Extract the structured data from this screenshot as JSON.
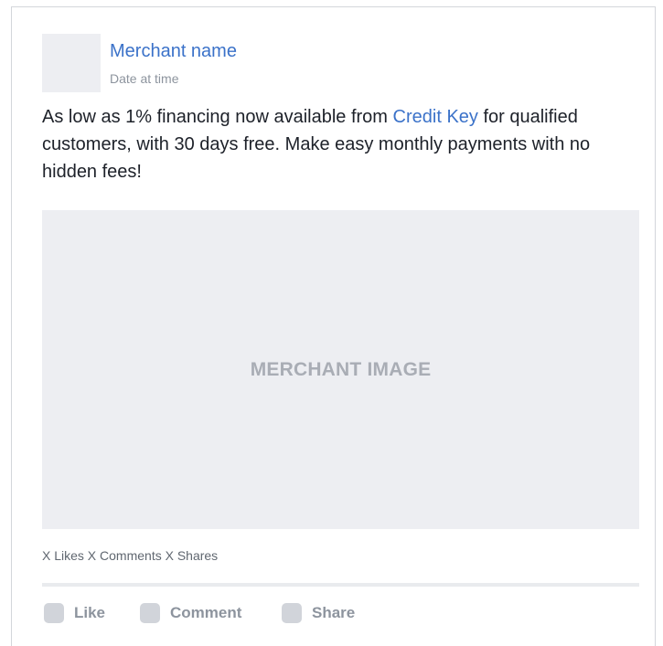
{
  "post": {
    "merchant_name": "Merchant name",
    "date": "Date at time",
    "body": {
      "before_link": "As low as 1% financing now available from ",
      "link_text": "Credit Key",
      "after_link": " for qualified customers, with 30 days free. Make easy monthly payments with no  hidden fees!"
    },
    "image_label": "MERCHANT IMAGE",
    "stats": "X Likes X Comments X Shares"
  },
  "actions": {
    "like_label": "Like",
    "comment_label": "Comment",
    "share_label": "Share"
  },
  "colors": {
    "link": "#3b72c9",
    "placeholder_bg": "#edeef2",
    "muted_text": "#8d949e"
  }
}
